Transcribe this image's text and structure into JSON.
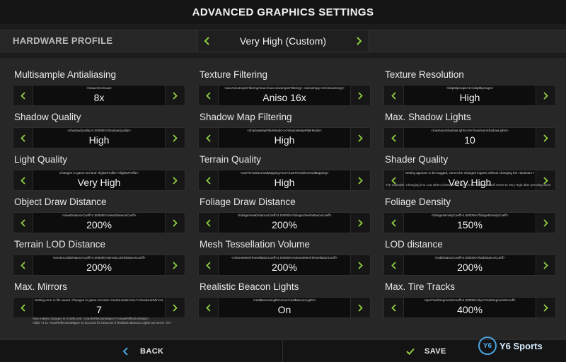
{
  "header": {
    "title": "ADVANCED GRAPHICS SETTINGS"
  },
  "profile": {
    "label": "HARDWARE PROFILE",
    "value": "Very High (Custom)"
  },
  "settings": [
    {
      "label": "Multisample Antialiasing",
      "value": "8x",
      "tip": "<msaa>8</msaa>"
    },
    {
      "label": "Texture Filtering",
      "value": "Aniso 16x",
      "tip": "<useAnisotropicFiltering>true</useAnisotropicFiltering> <anisotropy>16</anisotropy>"
    },
    {
      "label": "Texture Resolution",
      "value": "High",
      "tip": "<skipMipmaps>1</skipMipmaps>"
    },
    {
      "label": "Shadow Quality",
      "value": "High",
      "tip": "<shadowQuality>2.000000</shadowQuality>"
    },
    {
      "label": "Shadow Map Filtering",
      "value": "High",
      "tip": "<shadowMapFilterMode>1</shadowMapFilterMode>"
    },
    {
      "label": "Max. Shadow Lights",
      "value": "10",
      "tip": "<maxNumShadowLights>10</maxNumShadowLights>"
    },
    {
      "label": "Light Quality",
      "value": "Very High",
      "tip": "Changes in game.xml and <lightsProfile></lightsProfile>"
    },
    {
      "label": "Terrain Quality",
      "value": "High",
      "tip": "<useTerrainNormalMapping>true</useTerrainNormalMapping>"
    },
    {
      "label": "Shader Quality",
      "value": "Very High",
      "tip": "Setting appears to be bugged, cannot be changed ingame without changing the Hardware Profile"
    },
    {
      "label": "Object Draw Distance",
      "value": "200%",
      "tip": "<viewDistanceCoeff>2.000000</viewDistanceCoeff>"
    },
    {
      "label": "Foliage Draw Distance",
      "value": "200%",
      "tip": "<foliageViewDistanceCoeff>2.000000</foliageViewDistanceCoeff>"
    },
    {
      "label": "Foliage Density",
      "value": "150%",
      "tip": "<foliageDensityCoeff>1.500000</foliageDensityCoeff>"
    },
    {
      "label": "Terrain LOD Distance",
      "value": "200%",
      "tip": "<terrainLODDistanceCoeff>2.000000</terrainLODDistanceCoeff>"
    },
    {
      "label": "Mesh Tessellation Volume",
      "value": "200%",
      "tip": "<volumeMeshTessellationCoeff>2.000000</volumeMeshTessellationCoeff>"
    },
    {
      "label": "LOD distance",
      "value": "200%",
      "tip": "<lodDistanceCoeff>2.000000</lodDistanceCoeff>"
    },
    {
      "label": "Max. Mirrors",
      "value": "7",
      "tip": "Setting error in file saved. Changes in game.xml and <maxNumMirrors>7</maxNumMirrors>"
    },
    {
      "label": "Realistic Beacon Lights",
      "value": "On",
      "tip": "<realBeaconLights>true</realBeaconLights>"
    },
    {
      "label": "Max. Tire Tracks",
      "value": "400%",
      "tip": "<tyreTrackSegmentsCoeff>4.000000</tyreTrackSegmentsCoeff>"
    }
  ],
  "notes": {
    "shader": "For example: Changing it to Low when chosen Very High in the Hardware will revert to Very High after pressing Save",
    "mirrors_1": "Also makes changes in GAME.xml: <maxReflectionMaps>7</maxReflectionMaps>",
    "mirrors_2": "Adds +1 to <maxReflectionMaps> to account for beacons if Realistic Beacon Lights are set to \"On\""
  },
  "footer": {
    "back_label": "BACK",
    "save_label": "SAVE"
  },
  "watermark": {
    "mark": "Y6",
    "text": "Y6 Sports"
  },
  "colors": {
    "accent": "#8fd13f",
    "background": "#1c1c1c",
    "panel": "#272727"
  }
}
